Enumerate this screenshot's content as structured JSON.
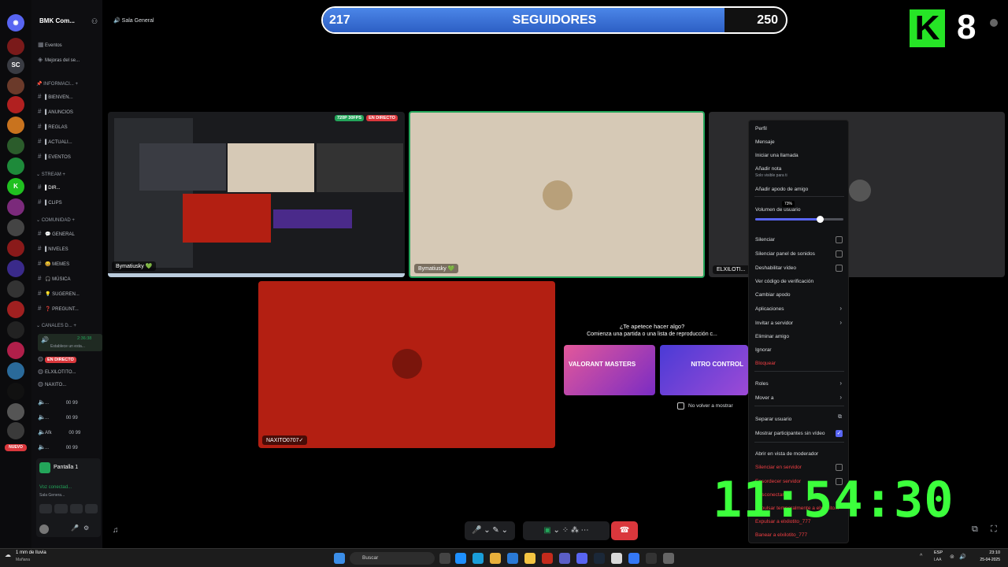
{
  "server": {
    "name": "BMK Com...",
    "voice_header": "Sala General"
  },
  "rail": {
    "items": [
      "SC",
      "NUEVO"
    ]
  },
  "sidebar": {
    "top_items": [
      "Eventos",
      "Mejoras del se..."
    ],
    "categories": [
      "INFORMACI...",
      "STREAM",
      "COMUNIDAD",
      "CANALES D..."
    ],
    "info_channels": [
      "BIENVEN...",
      "ANUNCIOS",
      "REGLAS",
      "ACTUALI...",
      "EVENTOS"
    ],
    "stream_channels": [
      "DIR...",
      "CLIPS"
    ],
    "community_channels": [
      "GENERAL",
      "NIVELES",
      "MEMES",
      "MÚSICA",
      "SUGEREN...",
      "PREGUNT..."
    ],
    "voice_users": [
      "EN DIRECTO",
      "ELXILOTITO...",
      "NAXITO..."
    ],
    "voice_channels": [
      {
        "name": "...",
        "count": "00 99"
      },
      {
        "name": "...",
        "count": "00 99"
      },
      {
        "name": "Afk",
        "count": "00 99"
      },
      {
        "name": "...",
        "count": "00 99"
      }
    ],
    "active_channel_time": "2:36:38",
    "active_channel_sub": "Establece un esta..."
  },
  "stream_panel": {
    "title": "Pantalla 1",
    "connected": "Voz conectad...",
    "room": "Sala Genera..."
  },
  "follower_bar": {
    "current": "217",
    "label": "SEGUIDORES",
    "goal": "250",
    "progress": 0.868
  },
  "streamer_logo": {
    "letter": "K",
    "number": "8"
  },
  "tiles": [
    {
      "name": "Bymatiusky 💚",
      "badge_quality": "720P 30FPS",
      "badge_live": "EN DIRECTO"
    },
    {
      "name": "Bymatiusky 💚"
    },
    {
      "name": "ELXILOTI..."
    },
    {
      "name": "NAXITO0707✓"
    }
  ],
  "activity": {
    "title": "¿Te apetece hacer algo?",
    "subtitle": "Comienza una partida o una lista de reproducción c...",
    "card1": "VALORANT MASTERS",
    "card2": "NITRO CONTROL",
    "dont_show": "No volver a mostrar"
  },
  "context_menu": {
    "items": [
      "Perfil",
      "Mensaje",
      "Iniciar una llamada",
      "Añadir nota",
      "Añadir apodo de amigo",
      "Volumen de usuario",
      "Silenciar",
      "Silenciar panel de sonidos",
      "Deshabilitar vídeo",
      "Ver código de verificación",
      "Cambiar apodo",
      "Aplicaciones",
      "Invitar a servidor",
      "Eliminar amigo",
      "Ignorar",
      "Bloquear",
      "Roles",
      "Mover a",
      "Separar usuario",
      "Mostrar participantes sin vídeo",
      "Abrir en vista de moderador",
      "Silenciar en servidor",
      "Ensordecer servidor",
      "Desconectar",
      "Expulsar temporalmente a elxilotito...",
      "Expulsar a elxilotito_777",
      "Banear a elxilotito_777"
    ],
    "note_sub": "Solo visible para ti",
    "volume_value": "73%",
    "volume": 0.73
  },
  "clock": "11:54:30",
  "taskbar": {
    "weather": "1 mm de lluvia",
    "weather_sub": "Mañana",
    "search": "Buscar",
    "lang": "ESP",
    "lang_sub": "LAA",
    "time": "23:10",
    "date": "25-04-2025"
  },
  "colors": {
    "accent": "#5865f2",
    "green": "#23a55a",
    "red": "#da373c",
    "clock": "#3cff3c",
    "bar": "#3f7be0"
  }
}
